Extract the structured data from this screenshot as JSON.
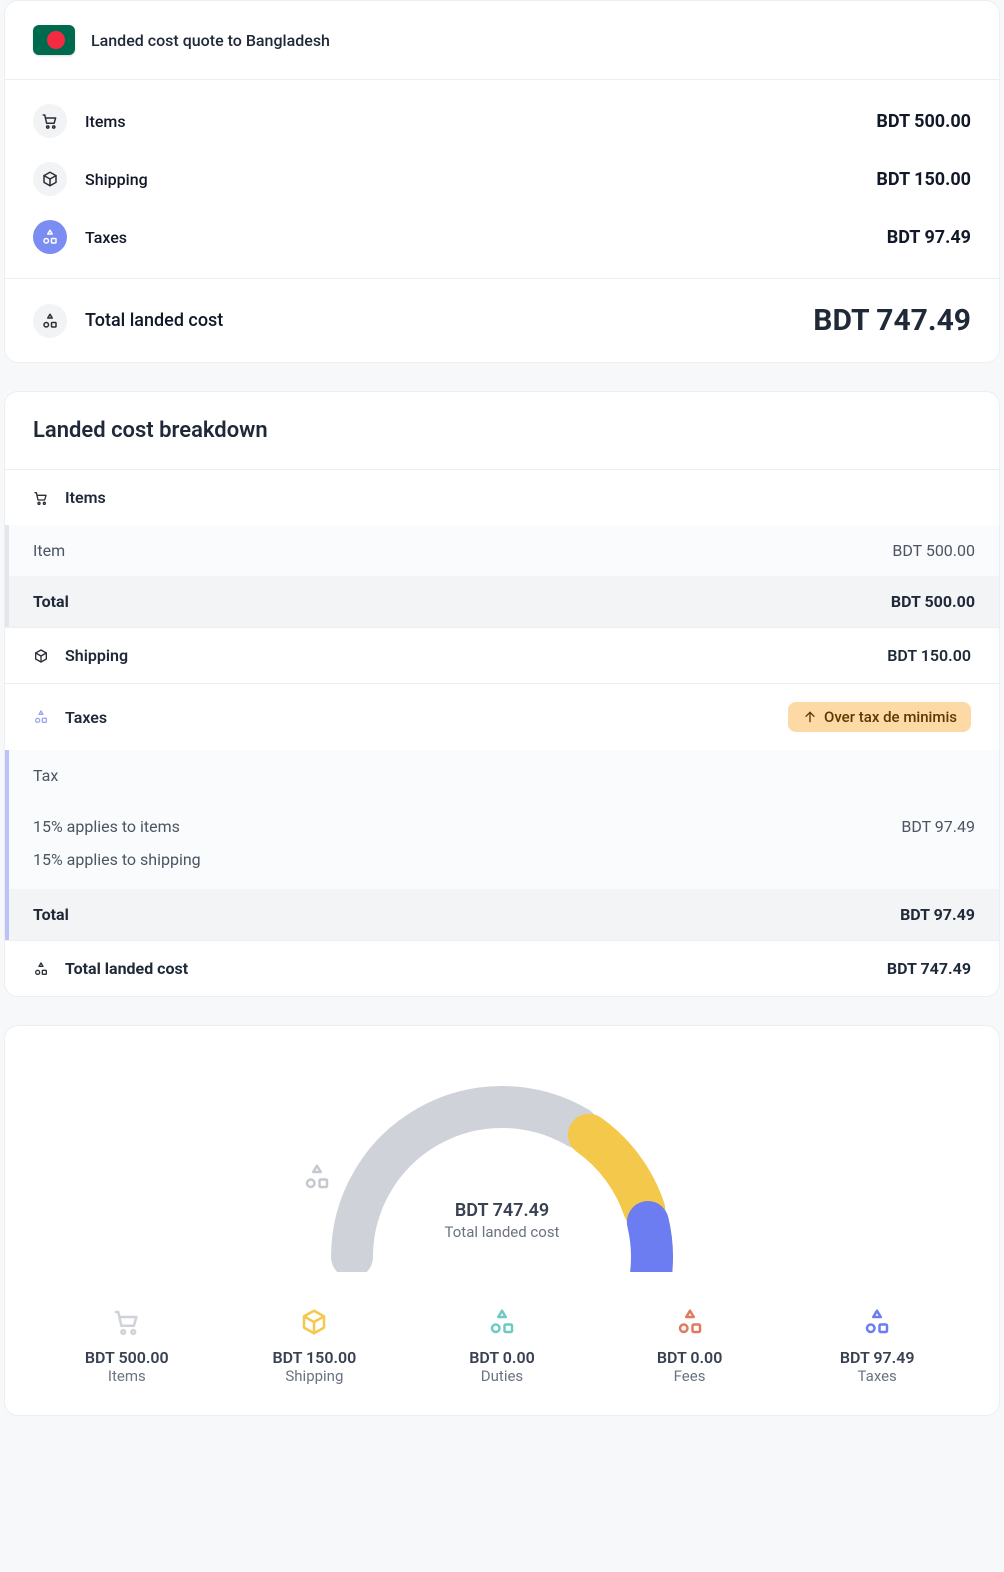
{
  "header": {
    "title": "Landed cost quote to Bangladesh"
  },
  "summary": {
    "items": {
      "label": "Items",
      "value": "BDT 500.00"
    },
    "shipping": {
      "label": "Shipping",
      "value": "BDT 150.00"
    },
    "taxes": {
      "label": "Taxes",
      "value": "BDT 97.49"
    },
    "total": {
      "label": "Total landed cost",
      "value": "BDT 747.49"
    }
  },
  "breakdown": {
    "title": "Landed cost breakdown",
    "items_header": "Items",
    "item_row": {
      "label": "Item",
      "value": "BDT 500.00"
    },
    "items_total": {
      "label": "Total",
      "value": "BDT 500.00"
    },
    "shipping": {
      "label": "Shipping",
      "value": "BDT 150.00"
    },
    "taxes_header": "Taxes",
    "de_minimis_badge": "Over tax de minimis",
    "tax_label": "Tax",
    "tax_line1": "15% applies to items",
    "tax_line1_value": "BDT 97.49",
    "tax_line2": "15% applies to shipping",
    "taxes_total": {
      "label": "Total",
      "value": "BDT 97.49"
    },
    "grand_total": {
      "label": "Total landed cost",
      "value": "BDT 747.49"
    }
  },
  "gauge": {
    "amount": "BDT 747.49",
    "caption": "Total landed cost",
    "legend": {
      "items": {
        "value": "BDT 500.00",
        "caption": "Items"
      },
      "shipping": {
        "value": "BDT 150.00",
        "caption": "Shipping"
      },
      "duties": {
        "value": "BDT 0.00",
        "caption": "Duties"
      },
      "fees": {
        "value": "BDT 0.00",
        "caption": "Fees"
      },
      "taxes": {
        "value": "BDT 97.49",
        "caption": "Taxes"
      }
    }
  },
  "chart_data": {
    "type": "pie",
    "title": "Total landed cost",
    "series": [
      {
        "name": "Items",
        "value": 500.0,
        "color": "#cfd3d9"
      },
      {
        "name": "Shipping",
        "value": 150.0,
        "color": "#f4c84a"
      },
      {
        "name": "Duties",
        "value": 0.0,
        "color": "#6ec9c1"
      },
      {
        "name": "Fees",
        "value": 0.0,
        "color": "#e07a5f"
      },
      {
        "name": "Taxes",
        "value": 97.49,
        "color": "#6c7cf1"
      }
    ],
    "total": 747.49,
    "currency": "BDT"
  }
}
